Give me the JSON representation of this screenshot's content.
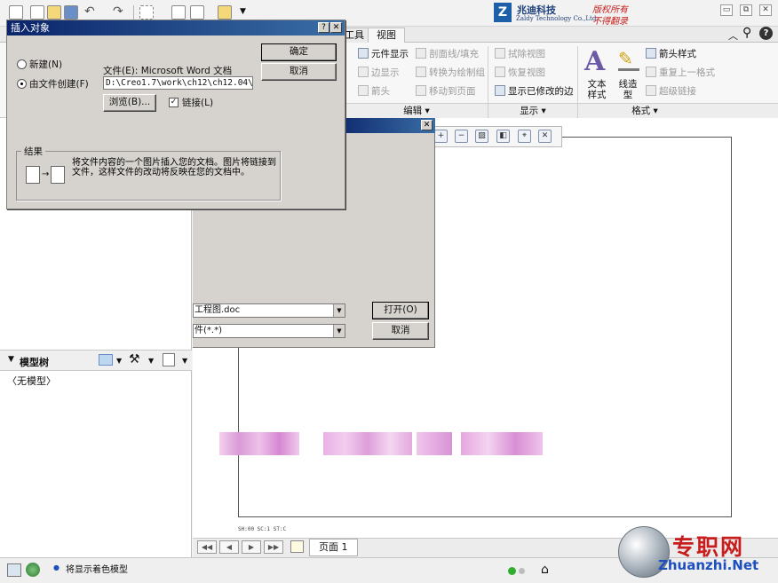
{
  "logo": {
    "mark": "Z",
    "cn": "兆迪科技",
    "en": "Zaldy Technology Co.,Ltd.",
    "red1": "版权所有",
    "red2": "不得翻录"
  },
  "window": {
    "minimize": "▭",
    "restore": "⧉",
    "close": "✕"
  },
  "tabs": [
    "工具",
    "视图"
  ],
  "ribbon": {
    "edit_col1": [
      "元件显示",
      "边显示",
      "箭头"
    ],
    "edit_col2": [
      "剖面线/填充",
      "转换为绘制组",
      "移动到页面"
    ],
    "display_col": [
      "拭除视图",
      "恢复视图",
      "显示已修改的边"
    ],
    "format_big1": "文本\n样式",
    "format_big2": "线造\n型",
    "format_col": [
      "箭头样式",
      "重复上一格式",
      "超级链接"
    ],
    "groups": {
      "edit": "编辑 ▾",
      "display": "显示 ▾",
      "format": "格式 ▾"
    }
  },
  "model_tree": {
    "title": "模型树",
    "empty": "〈无模型〉"
  },
  "open_dialog": {
    "filename": "工程图.doc",
    "filetype": "件(*.*)",
    "open_label": "打开(O)",
    "cancel_label": "取消"
  },
  "insert_dialog": {
    "title": "插入对象",
    "ok_label": "确定",
    "cancel_label": "取消",
    "radio_new": "新建(N)",
    "radio_from_file": "由文件创建(F)",
    "file_label": "文件(E): Microsoft Word 文档",
    "file_path": "D:\\Creo1.7\\work\\ch12\\ch12.04\\ch1",
    "browse_label": "浏览(B)...",
    "link_label": "链接(L)",
    "result_title": "结果",
    "result_text": "将文件内容的一个图片插入您的文档。图片将链接到 文件，这样文件的改动将反映在您的文档中。"
  },
  "page_bar": {
    "page_label": "页面 1"
  },
  "canvas_footer": "SH:00 SC:1 ST:C",
  "status": {
    "message": "将显示着色模型"
  },
  "watermark": {
    "cn": "专职网",
    "url": "Zhuanzhi.Net"
  },
  "colors": {
    "dialog_title": "#0a246a",
    "accent_red": "#c8201d",
    "accent_blue": "#1d4fbd",
    "blur_pink": "#e6a6e0"
  }
}
